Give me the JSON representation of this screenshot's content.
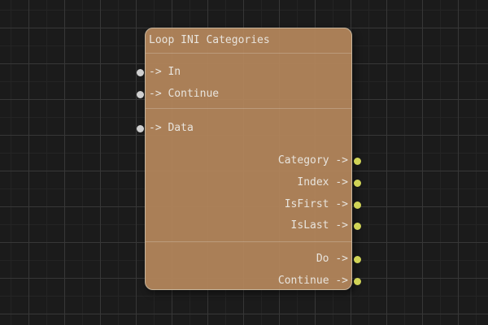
{
  "canvas": {
    "bg_color": "#1b1b1b",
    "grid_minor_color": "#242424",
    "grid_major_color": "#373737"
  },
  "node": {
    "title": "Loop INI Categories",
    "inputs": [
      {
        "label": "-> In"
      },
      {
        "label": "-> Continue"
      },
      {
        "label": "-> Data"
      }
    ],
    "outputs": [
      {
        "label": "Category ->"
      },
      {
        "label": "Index ->"
      },
      {
        "label": "IsFirst ->"
      },
      {
        "label": "IsLast ->"
      },
      {
        "label": "Do ->"
      },
      {
        "label": "Continue ->"
      }
    ],
    "colors": {
      "body": "rgba(181,135,91,0.93)",
      "border": "#c7b59c",
      "text": "#e8e4dd",
      "input_port": "#cfcfcf",
      "output_port": "#d0d356"
    }
  }
}
